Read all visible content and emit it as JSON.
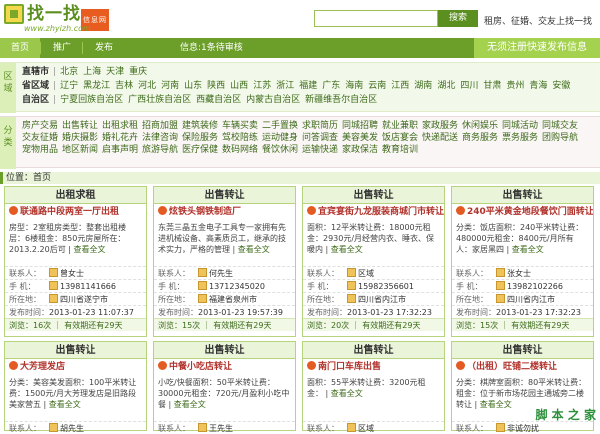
{
  "header": {
    "logo_text": "找一找",
    "logo_tag": "信息网",
    "logo_url": "www.zhyizh.com",
    "search_btn": "搜索",
    "slogan": "租房、征婚、交友上找一找"
  },
  "nav": {
    "items": [
      "首页",
      "推广",
      "发布"
    ],
    "info": "信息:1条待审核",
    "cta": "无须注册快速发布信息"
  },
  "region": {
    "side": "区域",
    "line1_key": "直辖市",
    "line1": [
      "北京",
      "上海",
      "天津",
      "重庆"
    ],
    "line2_key": "省区域",
    "line2": [
      "辽宁",
      "黑龙江",
      "吉林",
      "河北",
      "河南",
      "山东",
      "陕西",
      "山西",
      "江苏",
      "浙江",
      "福建",
      "广东",
      "海南",
      "云南",
      "江西",
      "湖南",
      "湖北",
      "四川",
      "甘肃",
      "贵州",
      "青海",
      "安徽"
    ],
    "line3_key": "自治区",
    "line3": [
      "宁夏回族自治区",
      "广西壮族自治区",
      "西藏自治区",
      "内蒙古自治区",
      "新疆维吾尔自治区"
    ]
  },
  "categories": {
    "side": "分类",
    "items": [
      "房产交易",
      "出售转让",
      "出租求租",
      "招商加盟",
      "建筑装修",
      "车辆买卖",
      "二手置换",
      "求职简历",
      "同城招聘",
      "就业兼职",
      "家政服务",
      "休闲娱乐",
      "同城活动",
      "同城交友",
      "交友征婚",
      "婚庆摄影",
      "婚礼花卉",
      "法律咨询",
      "保险服务",
      "驾校陪练",
      "运动健身",
      "问答调查",
      "美容美发",
      "饭店宴会",
      "快递配送",
      "商务服务",
      "票务服务",
      "团购导航",
      "宠物用品",
      "地区新闻",
      "启事声明",
      "旅游导航",
      "医疗保健",
      "数码网络",
      "餐饮休闲",
      "运输快递",
      "家政保洁",
      "教育培训"
    ]
  },
  "crumb": "位置：首页",
  "cards": [
    {
      "title": "出租求租",
      "sub": "联通路中段两室一厅出租",
      "desc": "房型：2室租房类型：整套出租楼层：6楼租金：850元房屋所在：2013.2.20后可",
      "more": "查看全文",
      "contact_label": "联系人：",
      "contact": "曾女士",
      "phone_label": "手 机：",
      "phone": "13981141666",
      "loc_label": "所在地：",
      "loc": "四川省遂宁市",
      "time_label": "发布时间：",
      "time": "2013-01-23 11:07:37",
      "foot": "浏览：16次 ｜ 有效期还有29天"
    },
    {
      "title": "出售转让",
      "sub": "炫铁头钢铁制造厂",
      "desc": "东莞三晶五金电子工具专一家拥有先进机械设备、高素质员工，继承的技术实力，严格的管理",
      "more": "查看全文",
      "contact_label": "联系人：",
      "contact": "何先生",
      "phone_label": "手 机：",
      "phone": "13712345020",
      "loc_label": "所在地：",
      "loc": "福建省泉州市",
      "time_label": "发布时间：",
      "time": "2013-01-23 19:57:39",
      "foot": "浏览：15次 ｜ 有效期还有29天"
    },
    {
      "title": "出售转让",
      "sub": "宜宾宴街九龙服装商城门市转让",
      "desc": "面积：12平米转让费：18000元租金：2930元/月经营内衣、睡衣、保暖内",
      "more": "查看全文",
      "contact_label": "联系人：",
      "contact": "区域",
      "phone_label": "手 机：",
      "phone": "15982356601",
      "loc_label": "所在地：",
      "loc": "四川省内江市",
      "time_label": "发布时间：",
      "time": "2013-01-23 17:32:23",
      "foot": "浏览：20次 ｜ 有效期还有29天"
    },
    {
      "title": "出售转让",
      "sub": "240平米黄金地段餐饮门面转让",
      "desc": "分类：饭店面积：240平米转让费：480000元租金：8400元/月所有人：家居黑四",
      "more": "查看全文",
      "contact_label": "联系人：",
      "contact": "张女士",
      "phone_label": "手 机：",
      "phone": "13982102266",
      "loc_label": "所在地：",
      "loc": "四川省内江市",
      "time_label": "发布时间：",
      "time": "2013-01-23 17:32:23",
      "foot": "浏览：15次 ｜ 有效期还有29天"
    },
    {
      "title": "出售转让",
      "sub": "大芳理发店",
      "desc": "分类：美容美发面积：100平米转让费：1500元/月大芳理发店是旧路段美家营五",
      "more": "查看全文",
      "contact_label": "联系人：",
      "contact": "胡先生",
      "phone_label": "手 机：",
      "phone": "",
      "loc_label": "",
      "loc": "",
      "time_label": "",
      "time": "",
      "foot": ""
    },
    {
      "title": "出售转让",
      "sub": "中餐小吃店转让",
      "desc": "小吃/快餐面积：50平米转让费：30000元租金：720元/月盈利小吃中餐",
      "more": "查看全文",
      "contact_label": "联系人：",
      "contact": "王先生",
      "phone_label": "手 机：",
      "phone": "",
      "loc_label": "",
      "loc": "",
      "time_label": "",
      "time": "",
      "foot": ""
    },
    {
      "title": "出售转让",
      "sub": "南门口车库出售",
      "desc": "面积：55平米转让费：3200元租金：",
      "more": "查看全文",
      "contact_label": "联系人：",
      "contact": "区域",
      "phone_label": "手 机：",
      "phone": "",
      "loc_label": "",
      "loc": "",
      "time_label": "",
      "time": "",
      "foot": ""
    },
    {
      "title": "出售转让",
      "sub": "（出租）旺铺二楼转让",
      "desc": "分类：棋牌室面积：80平米转让费：租金：位于新市场花园主通城旁二楼转让",
      "more": "查看全文",
      "contact_label": "联系人：",
      "contact": "非诚勿扰",
      "phone_label": "手 机：",
      "phone": "",
      "loc_label": "",
      "loc": "",
      "time_label": "",
      "time": "",
      "foot": ""
    }
  ],
  "watermark": "脚 本 之 家"
}
